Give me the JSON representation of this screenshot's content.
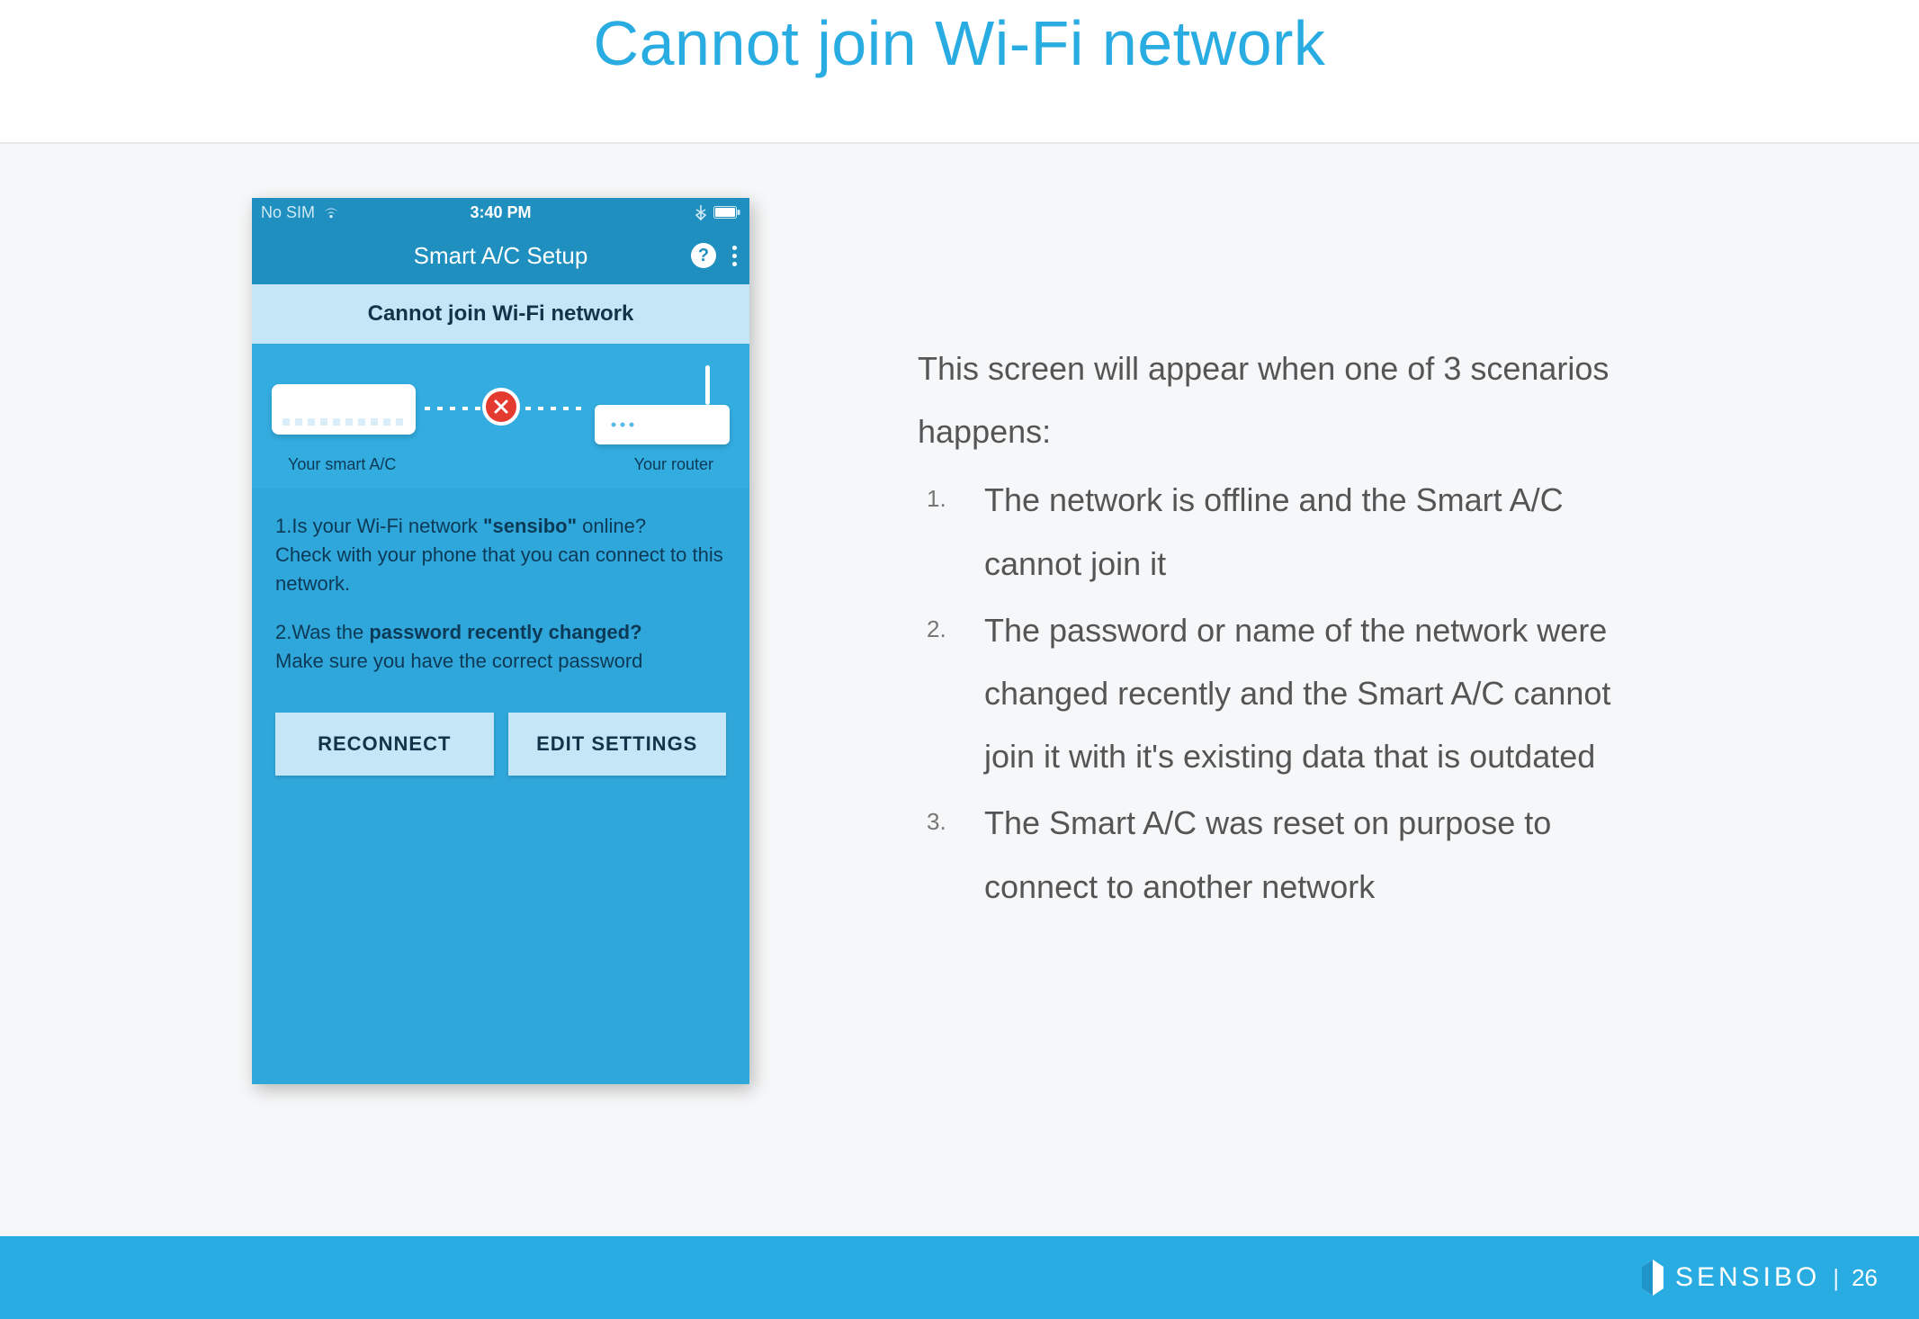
{
  "header": {
    "title": "Cannot join Wi-Fi network"
  },
  "phone": {
    "status_bar": {
      "carrier": "No SIM",
      "time": "3:40 PM"
    },
    "app_bar": {
      "title": "Smart A/C Setup",
      "help_glyph": "?"
    },
    "error_banner": "Cannot join Wi-Fi network",
    "diagram": {
      "left_label": "Your smart A/C",
      "right_label": "Your router"
    },
    "troubleshoot": {
      "q1_prefix": "1.Is your Wi-Fi network ",
      "q1_bold": "\"sensibo\"",
      "q1_suffix": " online?",
      "q1_line2": "Check with your phone that you can connect to this network.",
      "q2_prefix": "2.Was the ",
      "q2_bold": "password recently changed?",
      "q2_line2": "Make sure you have the correct password"
    },
    "buttons": {
      "reconnect": "RECONNECT",
      "edit_settings": "EDIT SETTINGS"
    }
  },
  "explain": {
    "intro": "This screen will appear when one of 3 scenarios happens:",
    "items": [
      "The network is offline and the Smart A/C cannot join it",
      "The password or name of the network were changed recently and the Smart A/C cannot join it with it's existing data that is outdated",
      "The Smart A/C was reset on purpose to connect to another network"
    ]
  },
  "footer": {
    "brand": "SENSIBO",
    "divider": "|",
    "page": "26"
  }
}
